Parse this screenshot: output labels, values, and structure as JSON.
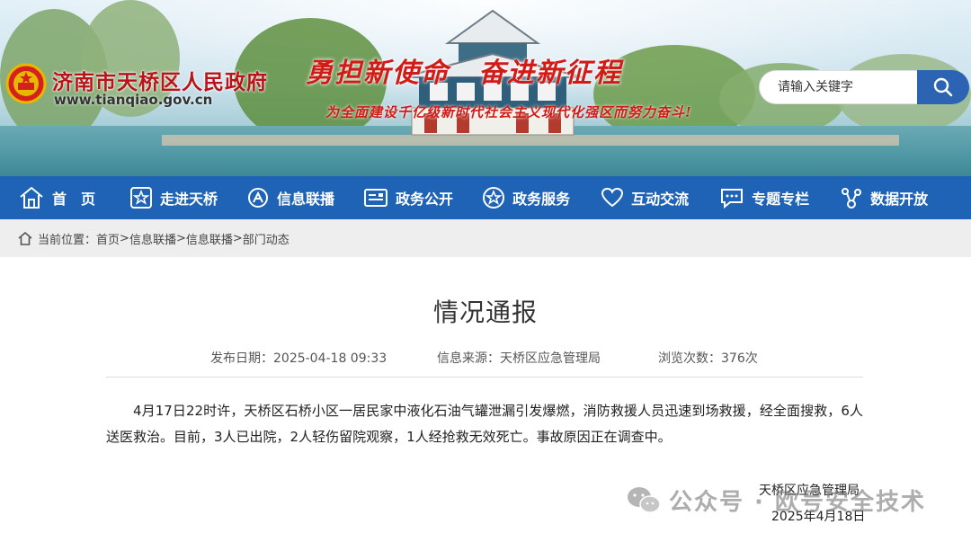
{
  "header": {
    "site_title": "济南市天桥区人民政府",
    "site_url": "www.tianqiao.gov.cn",
    "slogan_main": "勇担新使命　奋进新征程",
    "slogan_sub": "为全面建设千亿级新时代社会主义现代化强区而努力奋斗!",
    "search": {
      "placeholder": "请输入关键字",
      "value": ""
    }
  },
  "nav": {
    "items": [
      {
        "label": "首　页",
        "icon": "home-icon"
      },
      {
        "label": "走进天桥",
        "icon": "star-badge-icon"
      },
      {
        "label": "信息联播",
        "icon": "broadcast-icon"
      },
      {
        "label": "政务公开",
        "icon": "document-icon"
      },
      {
        "label": "政务服务",
        "icon": "service-star-icon"
      },
      {
        "label": "互动交流",
        "icon": "heart-icon"
      },
      {
        "label": "专题专栏",
        "icon": "chat-icon"
      },
      {
        "label": "数据开放",
        "icon": "network-icon"
      }
    ]
  },
  "breadcrumb": {
    "prefix": "当前位置：",
    "items": [
      "首页",
      "信息联播",
      "信息联播",
      "部门动态"
    ],
    "separator": ">"
  },
  "article": {
    "title": "情况通报",
    "publish_date": "发布日期：2025-04-18 09:33",
    "source": "信息来源：天桥区应急管理局",
    "views": "浏览次数：376次",
    "body": "4月17日22时许，天桥区石桥小区一居民家中液化石油气罐泄漏引发爆燃，消防救援人员迅速到场救援，经全面搜救，6人送医救治。目前，3人已出院，2人轻伤留院观察，1人经抢救无效死亡。事故原因正在调查中。",
    "signature": "天桥区应急管理局",
    "sign_date": "2025年4月18日"
  },
  "watermark": {
    "text": "公众号 · 欧号安全技术",
    "icon": "wechat-icon"
  },
  "colors": {
    "nav_bg": "#1e63b5",
    "title_red": "#b8141a",
    "search_btn": "#2c63b3",
    "breadcrumb_bg": "#eeeeee"
  }
}
